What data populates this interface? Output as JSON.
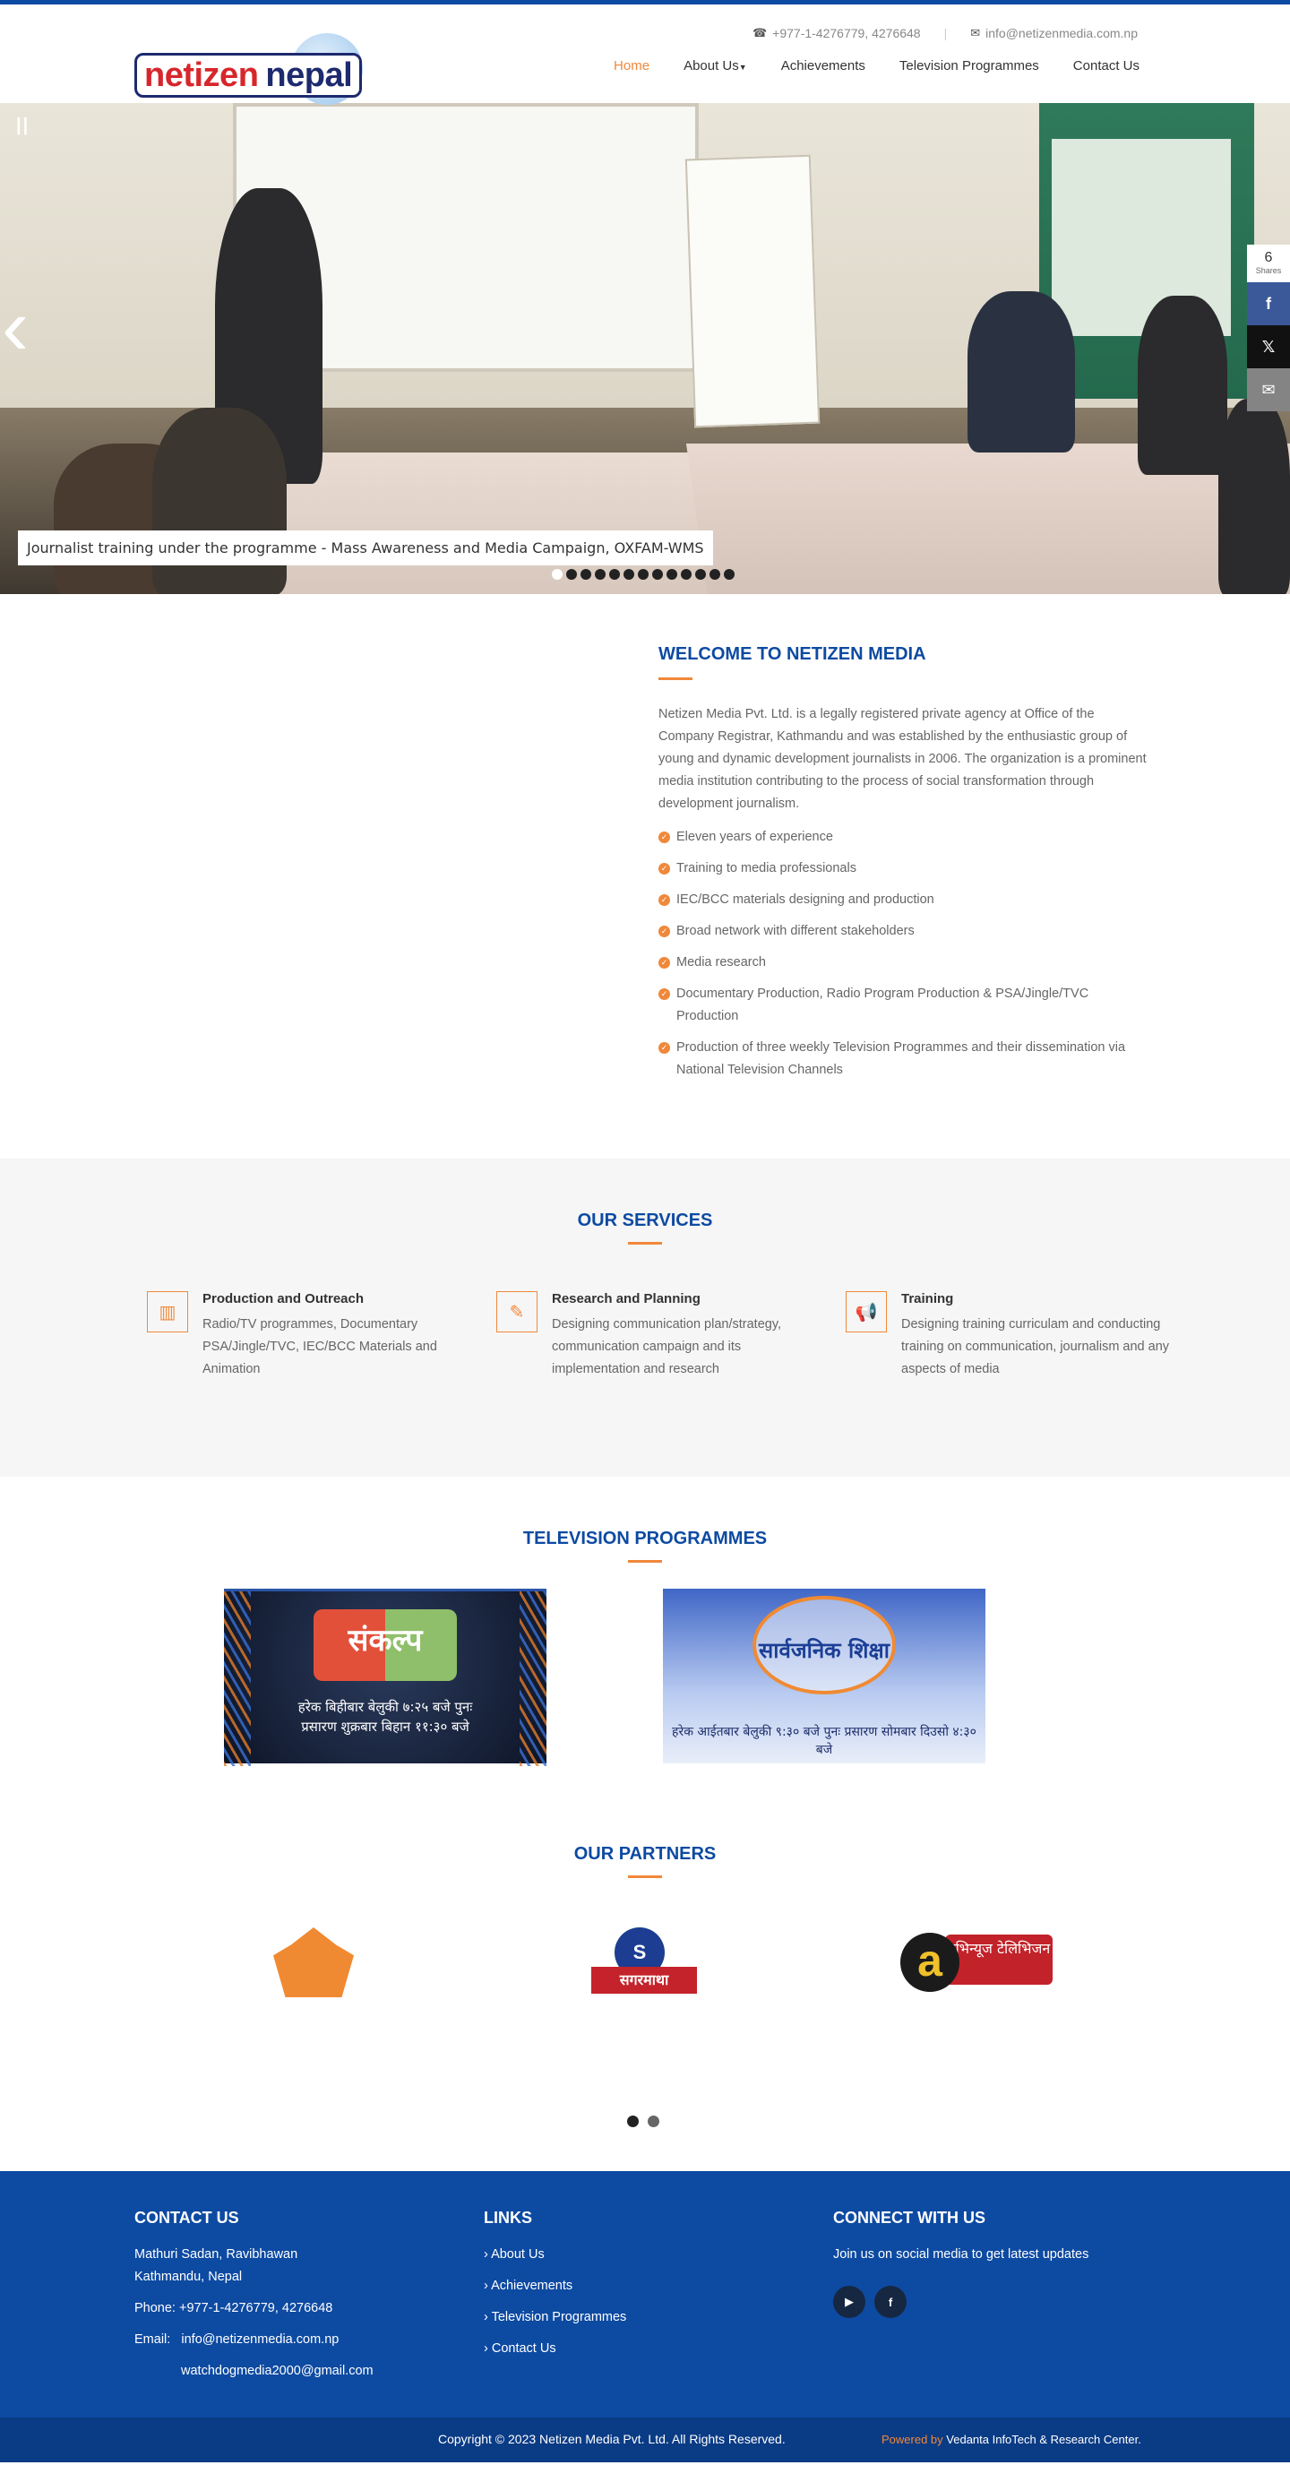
{
  "header": {
    "phone": "+977-1-4276779, 4276648",
    "email": "info@netizenmedia.com.np",
    "logo_part1": "netizen",
    "logo_part2": "nepal",
    "nav": [
      {
        "label": "Home",
        "active": true
      },
      {
        "label": "About Us",
        "dropdown": true
      },
      {
        "label": "Achievements"
      },
      {
        "label": "Television Programmes"
      },
      {
        "label": "Contact Us"
      }
    ]
  },
  "slider": {
    "caption": "Journalist training under the programme - Mass Awareness and Media Campaign, OXFAM-WMS",
    "pause_glyph": "||",
    "prev_glyph": "‹",
    "next_glyph": "›",
    "dot_count": 13,
    "active_dot": 0
  },
  "share": {
    "count": "6",
    "count_label": "Shares",
    "facebook_glyph": "f",
    "twitter_glyph": "𝕏",
    "email_glyph": "✉"
  },
  "welcome": {
    "title": "WELCOME TO NETIZEN MEDIA",
    "paragraph": "Netizen Media Pvt. Ltd. is a legally registered private agency at Office of the Company Registrar, Kathmandu and was established by the enthusiastic group of young and dynamic development journalists in 2006. The organization is a prominent media institution contributing to the process of social transformation through development journalism.",
    "points": [
      "Eleven years of experience",
      "Training to media professionals",
      "IEC/BCC materials designing and production",
      "Broad network with different stakeholders",
      "Media research",
      "Documentary Production, Radio Program Production & PSA/Jingle/TVC Production",
      "Production of three weekly Television Programmes and their dissemination via National Television Channels"
    ]
  },
  "services": {
    "title": "OUR SERVICES",
    "items": [
      {
        "title": "Production and Outreach",
        "desc": "Radio/TV programmes, Documentary PSA/Jingle/TVC, IEC/BCC Materials and Animation",
        "icon": "bar-chart-icon",
        "glyph": "▥"
      },
      {
        "title": "Research and Planning",
        "desc": "Designing communication plan/strategy, communication campaign and its implementation and research",
        "icon": "edit-icon",
        "glyph": "✎"
      },
      {
        "title": "Training",
        "desc": "Designing training curriculam and conducting training on communication, journalism and any aspects of media",
        "icon": "megaphone-icon",
        "glyph": "📢"
      }
    ]
  },
  "tv": {
    "title": "TELEVISION PROGRAMMES",
    "prog1_badge": "संकल्प",
    "prog1_text": "हरेक बिहीबार बेलुकी ७:२५ बजे पुनः प्रसारण शुक्रबार बिहान ११:३० बजे",
    "prog2_title": "सार्वजनिक शिक्षा",
    "prog2_text": "हरेक आईतबार बेलुकी ९:३० बजे पुनः प्रसारण सोमबार दिउसो ४:३० बजे"
  },
  "partners": {
    "title": "OUR PARTNERS",
    "logo2_circle": "S",
    "logo2_band": "सगरमाथा",
    "logo3_letter": "a",
    "logo3_text": "एभिन्यूज टेलिभिजन"
  },
  "footer": {
    "contact_title": "CONTACT US",
    "address1": "Mathuri Sadan, Ravibhawan",
    "address2": "Kathmandu, Nepal",
    "phone": "Phone: +977-1-4276779, 4276648",
    "email_label": "Email:",
    "email1": "info@netizenmedia.com.np",
    "email2": "watchdogmedia2000@gmail.com",
    "links_title": "LINKS",
    "links": [
      "About Us",
      "Achievements",
      "Television Programmes",
      "Contact Us"
    ],
    "connect_title": "CONNECT WITH US",
    "connect_text": "Join us on social media to get latest updates",
    "youtube_glyph": "▶",
    "facebook_glyph": "f",
    "copyright": "Copyright © 2023 Netizen Media Pvt. Ltd. All Rights Reserved.",
    "powered_by": "Powered by",
    "vendor": "Vedanta InfoTech & Research Center."
  },
  "colors": {
    "brand_blue": "#0d4aa2",
    "accent_orange": "#f0883a"
  }
}
